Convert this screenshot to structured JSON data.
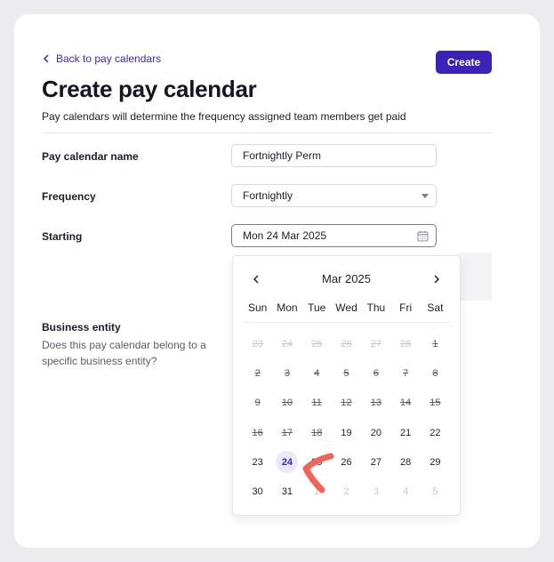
{
  "header": {
    "back_label": "Back to pay calendars",
    "create_label": "Create",
    "title": "Create pay calendar",
    "subtitle": "Pay calendars will determine the frequency assigned team members get paid"
  },
  "form": {
    "name_label": "Pay calendar name",
    "name_value": "Fortnightly Perm",
    "frequency_label": "Frequency",
    "frequency_value": "Fortnightly",
    "starting_label": "Starting",
    "starting_value": "Mon 24 Mar 2025",
    "entity_title": "Business entity",
    "entity_desc": "Does this pay calendar belong to a specific business entity?"
  },
  "calendar": {
    "month_label": "Mar 2025",
    "weekdays": [
      "Sun",
      "Mon",
      "Tue",
      "Wed",
      "Thu",
      "Fri",
      "Sat"
    ],
    "weeks": [
      [
        {
          "d": "23",
          "o": true,
          "x": true
        },
        {
          "d": "24",
          "o": true,
          "x": true
        },
        {
          "d": "25",
          "o": true,
          "x": true
        },
        {
          "d": "26",
          "o": true,
          "x": true
        },
        {
          "d": "27",
          "o": true,
          "x": true
        },
        {
          "d": "28",
          "o": true,
          "x": true
        },
        {
          "d": "1",
          "x": true
        }
      ],
      [
        {
          "d": "2",
          "x": true
        },
        {
          "d": "3",
          "x": true
        },
        {
          "d": "4",
          "x": true
        },
        {
          "d": "5",
          "x": true
        },
        {
          "d": "6",
          "x": true
        },
        {
          "d": "7",
          "x": true
        },
        {
          "d": "8",
          "x": true
        }
      ],
      [
        {
          "d": "9",
          "x": true
        },
        {
          "d": "10",
          "x": true
        },
        {
          "d": "11",
          "x": true
        },
        {
          "d": "12",
          "x": true
        },
        {
          "d": "13",
          "x": true
        },
        {
          "d": "14",
          "x": true
        },
        {
          "d": "15",
          "x": true
        }
      ],
      [
        {
          "d": "16",
          "x": true
        },
        {
          "d": "17",
          "x": true
        },
        {
          "d": "18",
          "x": true
        },
        {
          "d": "19"
        },
        {
          "d": "20"
        },
        {
          "d": "21"
        },
        {
          "d": "22"
        }
      ],
      [
        {
          "d": "23"
        },
        {
          "d": "24",
          "s": true
        },
        {
          "d": "25"
        },
        {
          "d": "26"
        },
        {
          "d": "27"
        },
        {
          "d": "28"
        },
        {
          "d": "29"
        }
      ],
      [
        {
          "d": "30"
        },
        {
          "d": "31"
        },
        {
          "d": "1",
          "o": true
        },
        {
          "d": "2",
          "o": true
        },
        {
          "d": "3",
          "o": true
        },
        {
          "d": "4",
          "o": true
        },
        {
          "d": "5",
          "o": true
        }
      ]
    ]
  },
  "colors": {
    "accent": "#3b22b8",
    "annotation": "#f0645a"
  }
}
